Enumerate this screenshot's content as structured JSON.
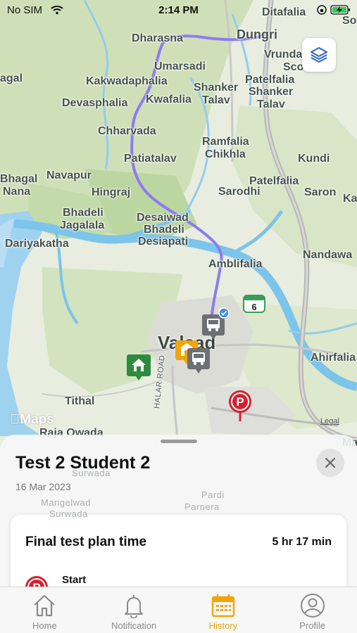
{
  "status_bar": {
    "carrier": "No SIM",
    "time": "2:14 PM"
  },
  "map": {
    "places": [
      {
        "name": "Ditafalia"
      },
      {
        "name": "So"
      },
      {
        "name": "Dharasna"
      },
      {
        "name": "Dungri"
      },
      {
        "name": "Vrunda"
      },
      {
        "name": "Sco"
      },
      {
        "name": "agal"
      },
      {
        "name": "Kakwadaphalia"
      },
      {
        "name": "Umarsadi"
      },
      {
        "name": "Patelfalia"
      },
      {
        "name": "Shanker"
      },
      {
        "name": "Shanker"
      },
      {
        "name": "Devasphalia"
      },
      {
        "name": "Kwafalia"
      },
      {
        "name": "Talav"
      },
      {
        "name": "Talav"
      },
      {
        "name": "Chharvada"
      },
      {
        "name": "Ramfalia"
      },
      {
        "name": "Chikhla"
      },
      {
        "name": "Patiatalav"
      },
      {
        "name": "Kundi"
      },
      {
        "name": "Bhagal"
      },
      {
        "name": "Navapur"
      },
      {
        "name": "Patelfalia"
      },
      {
        "name": "Nana"
      },
      {
        "name": "Hingraj"
      },
      {
        "name": "Sarodhi"
      },
      {
        "name": "Saron"
      },
      {
        "name": "Ka"
      },
      {
        "name": "Bhadeli"
      },
      {
        "name": "Desaiwad"
      },
      {
        "name": "Jagalala"
      },
      {
        "name": "Bhadeli"
      },
      {
        "name": "Desiapati"
      },
      {
        "name": "Dariyakatha"
      },
      {
        "name": "Nandawa"
      },
      {
        "name": "Amblifalia"
      },
      {
        "name": "Valsad"
      },
      {
        "name": "Ahirfalia"
      },
      {
        "name": "Tithal"
      },
      {
        "name": "HALAR ROAD"
      },
      {
        "name": "Raja Owada"
      },
      {
        "name": "Surwada"
      },
      {
        "name": "Mangelwad"
      },
      {
        "name": "Surwada"
      },
      {
        "name": "Pardi"
      },
      {
        "name": "Parnera"
      },
      {
        "name": "Ma"
      }
    ],
    "highway_badge": "6",
    "maps_logo": "Maps",
    "legal_link": "Legal"
  },
  "icons": {
    "layers": "layers-icon",
    "close": "close-icon",
    "bus": "bus-icon",
    "home": "house-icon",
    "school": "school-icon",
    "parking": "parking-icon"
  },
  "sheet": {
    "title": "Test 2 Student 2",
    "date": "16 Mar 2023",
    "card": {
      "title": "Final test plan time",
      "value": "5 hr 17 min",
      "start_label": "Start"
    }
  },
  "tab_bar": {
    "tabs": [
      {
        "label": "Home",
        "icon": "house-outline-icon",
        "active": false
      },
      {
        "label": "Notification",
        "icon": "bell-icon",
        "active": false
      },
      {
        "label": "History",
        "icon": "calendar-icon",
        "active": true
      },
      {
        "label": "Profile",
        "icon": "person-circle-icon",
        "active": false
      }
    ]
  },
  "colors": {
    "route": "#8b7cf0",
    "accent": "#f0a60a",
    "sea": "#9fd2ef",
    "river": "#7cc4ea",
    "land_green": "#cfe0b8",
    "parking_red": "#d6202f",
    "home_green": "#2e8b3e"
  }
}
